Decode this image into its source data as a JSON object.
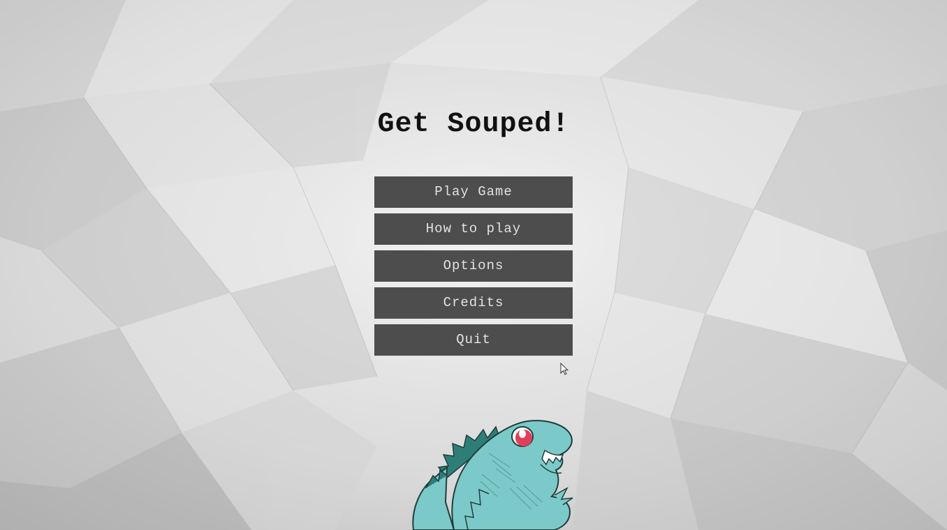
{
  "title": "Get Souped!",
  "menu": {
    "items": [
      {
        "label": "Play Game"
      },
      {
        "label": "How to play"
      },
      {
        "label": "Options"
      },
      {
        "label": "Credits"
      },
      {
        "label": "Quit"
      }
    ]
  },
  "colors": {
    "button_bg": "#4d4d4d",
    "button_text": "#e2e2e2",
    "title_text": "#111111",
    "dino_body": "#7cc9c9",
    "dino_eye": "#e0405a"
  },
  "icons": {
    "cursor": "mouse-pointer-icon",
    "mascot": "dinosaur-mascot"
  }
}
